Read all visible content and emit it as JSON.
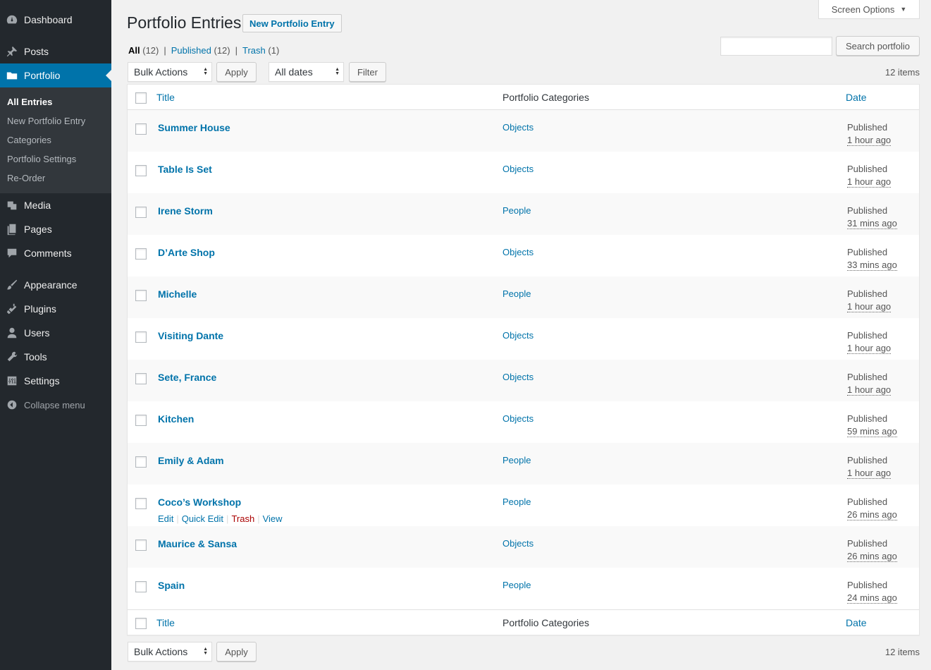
{
  "sidebar": {
    "items": [
      {
        "label": "Dashboard",
        "icon": "dashboard-icon"
      },
      {
        "label": "Posts",
        "icon": "pin-icon"
      },
      {
        "label": "Portfolio",
        "icon": "folder-icon"
      },
      {
        "label": "Media",
        "icon": "media-icon"
      },
      {
        "label": "Pages",
        "icon": "pages-icon"
      },
      {
        "label": "Comments",
        "icon": "comment-icon"
      },
      {
        "label": "Appearance",
        "icon": "brush-icon"
      },
      {
        "label": "Plugins",
        "icon": "plugin-icon"
      },
      {
        "label": "Users",
        "icon": "user-icon"
      },
      {
        "label": "Tools",
        "icon": "wrench-icon"
      },
      {
        "label": "Settings",
        "icon": "settings-icon"
      }
    ],
    "submenu": [
      "All Entries",
      "New Portfolio Entry",
      "Categories",
      "Portfolio Settings",
      "Re-Order"
    ],
    "collapse_label": "Collapse menu"
  },
  "screen_options": "Screen Options",
  "page_title": "Portfolio Entries",
  "add_new_label": "New Portfolio Entry",
  "views": {
    "all": "All",
    "all_count": "(12)",
    "published": "Published",
    "published_count": "(12)",
    "trash": "Trash",
    "trash_count": "(1)",
    "sep": "|"
  },
  "search_button": "Search portfolio",
  "bulk_actions": "Bulk Actions",
  "apply": "Apply",
  "all_dates": "All dates",
  "filter": "Filter",
  "items_count": "12 items",
  "columns": {
    "title": "Title",
    "categories": "Portfolio Categories",
    "date": "Date"
  },
  "rows": [
    {
      "title": "Summer House",
      "category": "Objects",
      "status": "Published",
      "time": "1 hour ago"
    },
    {
      "title": "Table Is Set",
      "category": "Objects",
      "status": "Published",
      "time": "1 hour ago"
    },
    {
      "title": "Irene Storm",
      "category": "People",
      "status": "Published",
      "time": "31 mins ago"
    },
    {
      "title": "D’Arte Shop",
      "category": "Objects",
      "status": "Published",
      "time": "33 mins ago"
    },
    {
      "title": "Michelle",
      "category": "People",
      "status": "Published",
      "time": "1 hour ago"
    },
    {
      "title": "Visiting Dante",
      "category": "Objects",
      "status": "Published",
      "time": "1 hour ago"
    },
    {
      "title": "Sete, France",
      "category": "Objects",
      "status": "Published",
      "time": "1 hour ago"
    },
    {
      "title": "Kitchen",
      "category": "Objects",
      "status": "Published",
      "time": "59 mins ago"
    },
    {
      "title": "Emily & Adam",
      "category": "People",
      "status": "Published",
      "time": "1 hour ago"
    },
    {
      "title": "Coco’s Workshop",
      "category": "People",
      "status": "Published",
      "time": "26 mins ago"
    },
    {
      "title": "Maurice & Sansa",
      "category": "Objects",
      "status": "Published",
      "time": "26 mins ago"
    },
    {
      "title": "Spain",
      "category": "People",
      "status": "Published",
      "time": "24 mins ago"
    }
  ],
  "row_actions": {
    "edit": "Edit",
    "quick_edit": "Quick Edit",
    "trash": "Trash",
    "view": "View",
    "sep": "|"
  },
  "colors": {
    "sidebar_bg": "#23282d",
    "accent": "#0073aa",
    "trash": "#a00"
  }
}
